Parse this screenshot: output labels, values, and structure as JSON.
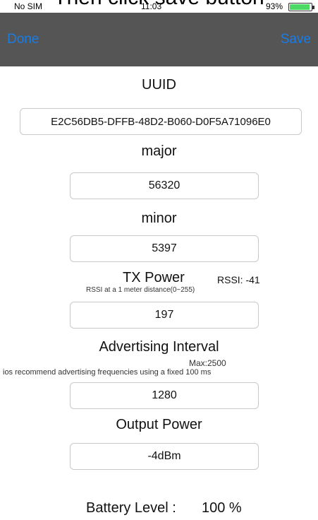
{
  "caption": "Then click save button",
  "status_bar": {
    "carrier": "No SIM",
    "time": "11:03",
    "battery": "93%"
  },
  "navbar": {
    "done_label": "Done",
    "save_label": "Save"
  },
  "uuid": {
    "label": "UUID",
    "value": "E2C56DB5-DFFB-48D2-B060-D0F5A71096E0"
  },
  "major": {
    "label": "major",
    "value": "56320"
  },
  "minor": {
    "label": "minor",
    "value": "5397"
  },
  "tx_power": {
    "label": "TX Power",
    "rssi": "RSSI: -41",
    "hint": "RSSI at a 1 meter distance(0~255)",
    "value": "197"
  },
  "advertising_interval": {
    "label": "Advertising Interval",
    "max": "Max:2500",
    "hint": "ios recommend advertising frequencies using a fixed 100 ms",
    "value": "1280"
  },
  "output_power": {
    "label": "Output Power",
    "value": "-4dBm"
  },
  "battery": {
    "label": "Battery Level :",
    "value": "100 %"
  },
  "colors": {
    "nav_background": "#555555",
    "nav_button": "#1a7be3",
    "field_border": "#c9c9c9"
  }
}
